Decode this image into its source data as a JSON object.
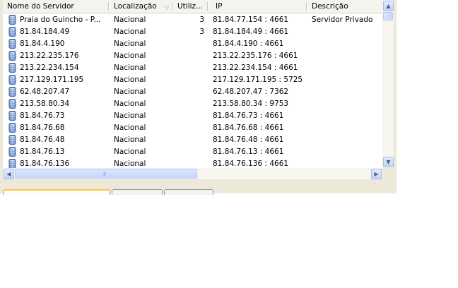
{
  "columns": [
    {
      "label": "Nome do Servidor"
    },
    {
      "label": "Localização"
    },
    {
      "label": "Utiliz..."
    },
    {
      "label": "IP"
    },
    {
      "label": "Descrição"
    }
  ],
  "rows": [
    {
      "name": "Praia do Guincho  -  P...",
      "location": "Nacional",
      "users": "3",
      "ip": "81.84.77.154 : 4661",
      "description": "Servidor Privado"
    },
    {
      "name": "81.84.184.49",
      "location": "Nacional",
      "users": "3",
      "ip": "81.84.184.49 : 4661",
      "description": ""
    },
    {
      "name": "81.84.4.190",
      "location": "Nacional",
      "users": "",
      "ip": "81.84.4.190 : 4661",
      "description": ""
    },
    {
      "name": "213.22.235.176",
      "location": "Nacional",
      "users": "",
      "ip": "213.22.235.176 : 4661",
      "description": ""
    },
    {
      "name": "213.22.234.154",
      "location": "Nacional",
      "users": "",
      "ip": "213.22.234.154 : 4661",
      "description": ""
    },
    {
      "name": "217.129.171.195",
      "location": "Nacional",
      "users": "",
      "ip": "217.129.171.195 : 5725",
      "description": ""
    },
    {
      "name": "62.48.207.47",
      "location": "Nacional",
      "users": "",
      "ip": "62.48.207.47 : 7362",
      "description": ""
    },
    {
      "name": "213.58.80.34",
      "location": "Nacional",
      "users": "",
      "ip": "213.58.80.34 : 9753",
      "description": ""
    },
    {
      "name": "81.84.76.73",
      "location": "Nacional",
      "users": "",
      "ip": "81.84.76.73 : 4661",
      "description": ""
    },
    {
      "name": "81.84.76.68",
      "location": "Nacional",
      "users": "",
      "ip": "81.84.76.68 : 4661",
      "description": ""
    },
    {
      "name": "81.84.76.48",
      "location": "Nacional",
      "users": "",
      "ip": "81.84.76.48 : 4661",
      "description": ""
    },
    {
      "name": "81.84.76.13",
      "location": "Nacional",
      "users": "",
      "ip": "81.84.76.13 : 4661",
      "description": ""
    },
    {
      "name": "81.84.76.136",
      "location": "Nacional",
      "users": "",
      "ip": "81.84.76.136 : 4661",
      "description": ""
    }
  ],
  "icons": {
    "server": "server-icon",
    "sort": "sort-descending-icon",
    "scroll_up": "arrow-up-icon",
    "scroll_down": "arrow-down-icon",
    "scroll_left": "arrow-left-icon",
    "scroll_right": "arrow-right-icon"
  },
  "colors": {
    "selected_tab_accent": "#ffc83c",
    "scrollbar": "#c7d7fc",
    "server_icon": "#5b7fb8"
  }
}
